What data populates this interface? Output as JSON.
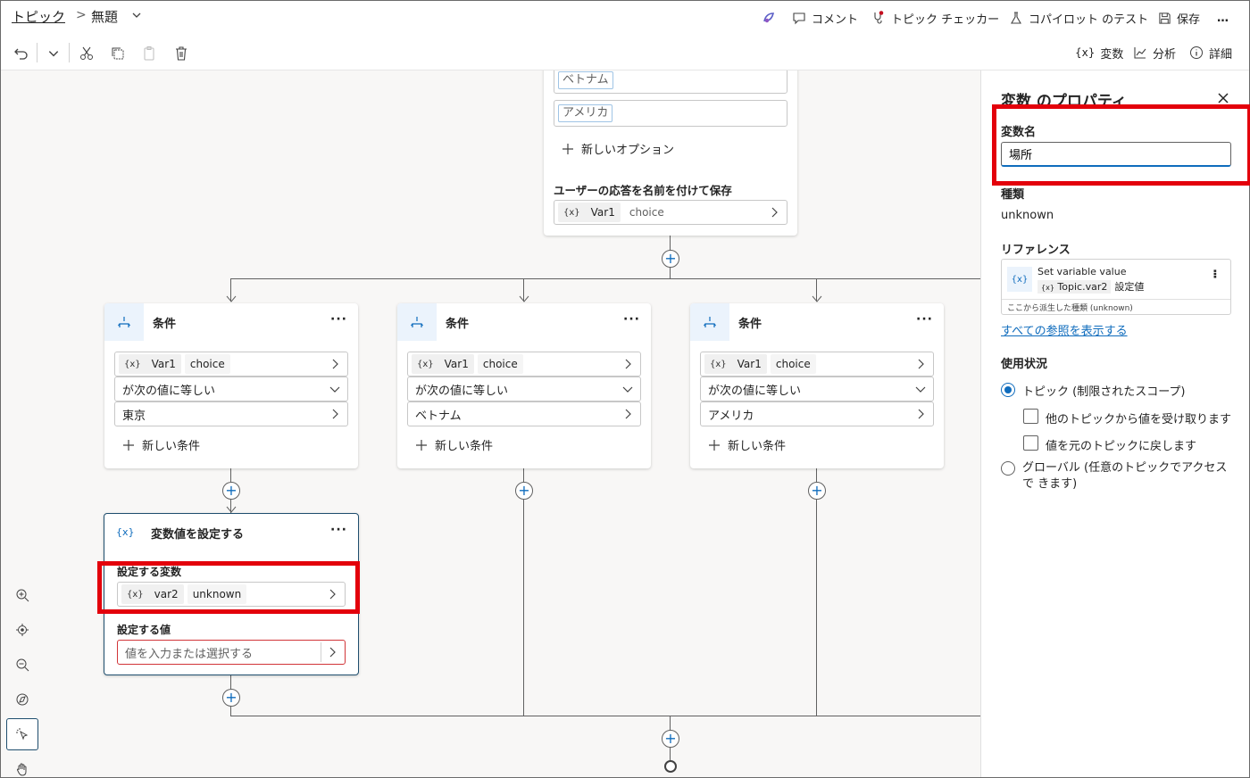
{
  "header": {
    "breadcrumb_root": "トピック",
    "breadcrumb_sep": ">",
    "breadcrumb_current": "無題",
    "actions": {
      "comment": "コメント",
      "checker": "トピック チェッカー",
      "test": "コパイロット のテスト",
      "save": "保存",
      "more": "…"
    }
  },
  "toolbar": {
    "variables": "変数",
    "analytics": "分析",
    "details": "詳細"
  },
  "question": {
    "options": [
      "ベトナム",
      "アメリカ"
    ],
    "new_option": "新しいオプション",
    "save_label": "ユーザーの応答を名前を付けて保存",
    "var_name": "Var1",
    "var_type": "choice",
    "var_icon": "{x}"
  },
  "conditions": [
    {
      "title": "条件",
      "var_name": "Var1",
      "var_type": "choice",
      "operator": "が次の値に等しい",
      "value": "東京",
      "new_condition": "新しい条件"
    },
    {
      "title": "条件",
      "var_name": "Var1",
      "var_type": "choice",
      "operator": "が次の値に等しい",
      "value": "ベトナム",
      "new_condition": "新しい条件"
    },
    {
      "title": "条件",
      "var_name": "Var1",
      "var_type": "choice",
      "operator": "が次の値に等しい",
      "value": "アメリカ",
      "new_condition": "新しい条件"
    }
  ],
  "set_variable": {
    "title": "変数値を設定する",
    "var_label": "設定する変数",
    "var_name": "var2",
    "var_type": "unknown",
    "value_label": "設定する値",
    "value_placeholder": "値を入力または選択する"
  },
  "panel": {
    "title": "変数 のプロパティ",
    "name_label": "変数名",
    "name_value": "場所",
    "type_label": "種類",
    "type_value": "unknown",
    "reference_label": "リファレンス",
    "reference": {
      "title": "Set variable value",
      "var": "Topic.var2",
      "role": "設定値",
      "note": "ここから派生した種類 (unknown)"
    },
    "show_all_refs": "すべての参照を表示する",
    "usage_label": "使用状況",
    "scope_topic": "トピック (制限されたスコープ)",
    "receive_values": "他のトピックから値を受け取ります",
    "return_values": "値を元のトピックに戻します",
    "scope_global": "グローバル (任意のトピックでアクセスで きます)"
  },
  "colors": {
    "accent": "#0f6cbd",
    "highlight": "#e3000b",
    "canvas": "#f8f7f6"
  }
}
